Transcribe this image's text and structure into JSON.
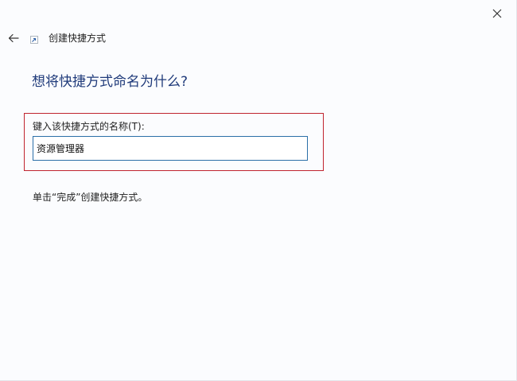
{
  "window": {
    "close_symbol": "×"
  },
  "header": {
    "back_icon": "back-arrow-icon",
    "wizard_icon": "shortcut-icon",
    "title": "创建快捷方式"
  },
  "main": {
    "question": "想将快捷方式命名为什么?",
    "name_field": {
      "label": "键入该快捷方式的名称(T):",
      "value": "资源管理器"
    },
    "hint": "单击“完成”创建快捷方式。"
  },
  "colors": {
    "background": "#fbfcfe",
    "question_text": "#1f3a7a",
    "highlight_border": "#c0242f",
    "input_border": "#2b6fa8"
  }
}
